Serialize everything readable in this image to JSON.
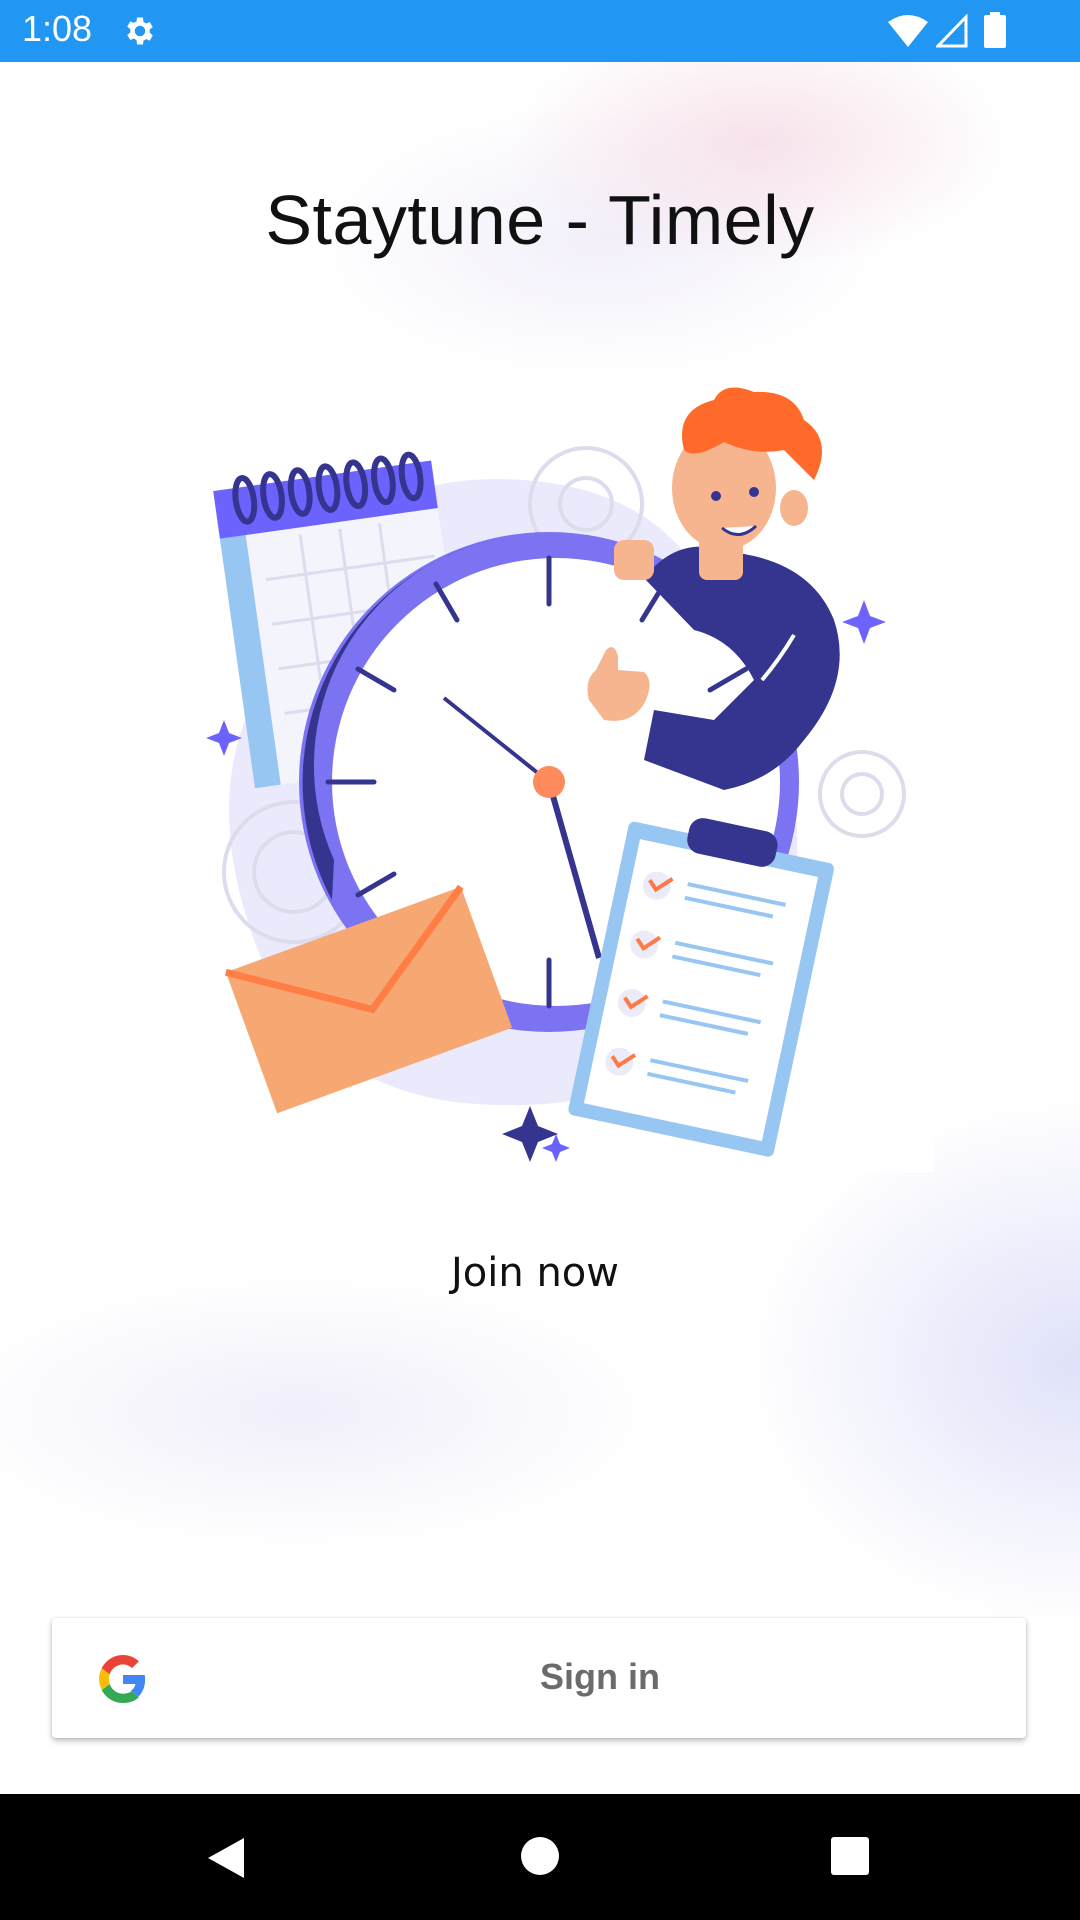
{
  "status_bar": {
    "time": "1:08",
    "icons": [
      "gear-icon",
      "wifi-icon",
      "cell-signal-icon",
      "battery-icon"
    ],
    "background": "#2196f3"
  },
  "header": {
    "title": "Staytune - Timely"
  },
  "illustration": {
    "icon": "time-management-illustration"
  },
  "main": {
    "join_label": "Join now"
  },
  "signin": {
    "label": "Sign in",
    "icon": "google-icon"
  },
  "nav_bar": {
    "icons": [
      "back-icon",
      "home-icon",
      "recents-icon"
    ]
  },
  "colors": {
    "accent": "#6c63ff",
    "dark_blue": "#35348f",
    "orange": "#ff7a45"
  }
}
